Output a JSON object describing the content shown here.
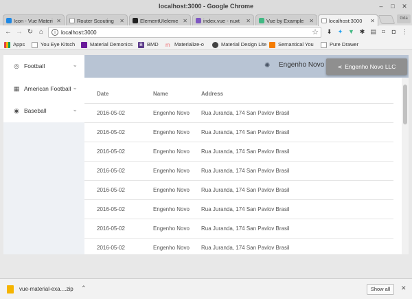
{
  "window": {
    "title": "localhost:3000 - Google Chrome"
  },
  "tabs": [
    {
      "label": "Icon - Vue Materi",
      "favicon_color": "#1e88e5",
      "active": false
    },
    {
      "label": "Router Scouting",
      "favicon_color": "#ffffff",
      "active": false
    },
    {
      "label": "ElementUIeleme",
      "favicon_color": "#222222",
      "active": false
    },
    {
      "label": "index.vue - nuxt",
      "favicon_color": "#7e57c2",
      "active": false
    },
    {
      "label": "Vue by Example",
      "favicon_color": "#41b883",
      "active": false
    },
    {
      "label": "localhost:3000",
      "favicon_color": "#ffffff",
      "active": true
    }
  ],
  "profile_label": "Gda",
  "toolbar": {
    "url": "localhost:3000"
  },
  "bookmarks": [
    {
      "label": "Apps",
      "icon_color": "#e04040"
    },
    {
      "label": "You Eye Kitsch",
      "icon_color": "#ffffff"
    },
    {
      "label": "Material Demonics",
      "icon_color": "#6a1b9a"
    },
    {
      "label": "BMD",
      "icon_color": "#5c3b8a"
    },
    {
      "label": "Materialize-o",
      "icon_color": "#ee6e73"
    },
    {
      "label": "Material Design Lite",
      "icon_color": "#424242"
    },
    {
      "label": "Semantical You",
      "icon_color": "#f57c00"
    },
    {
      "label": "Pure Drawer",
      "icon_color": "#ffffff"
    }
  ],
  "sidebar": {
    "items": [
      {
        "label": "Football",
        "icon": "football-icon"
      },
      {
        "label": "American Football",
        "icon": "grid-icon"
      },
      {
        "label": "Baseball",
        "icon": "baseball-icon"
      }
    ]
  },
  "appbar": {
    "title": "Engenho Novo",
    "button_label": "Engenho Novo LLC",
    "color": "#b8c4d4"
  },
  "table": {
    "columns": [
      "Date",
      "Name",
      "Address"
    ],
    "rows": [
      [
        "2016-05-02",
        "Engenho Novo",
        "Rua Juranda, 174 San Pavlov Brasil"
      ],
      [
        "2016-05-02",
        "Engenho Novo",
        "Rua Juranda, 174 San Pavlov Brasil"
      ],
      [
        "2016-05-02",
        "Engenho Novo",
        "Rua Juranda, 174 San Pavlov Brasil"
      ],
      [
        "2016-05-02",
        "Engenho Novo",
        "Rua Juranda, 174 San Pavlov Brasil"
      ],
      [
        "2016-05-02",
        "Engenho Novo",
        "Rua Juranda, 174 San Pavlov Brasil"
      ],
      [
        "2016-05-02",
        "Engenho Novo",
        "Rua Juranda, 174 San Pavlov Brasil"
      ],
      [
        "2016-05-02",
        "Engenho Novo",
        "Rua Juranda, 174 San Pavlov Brasil"
      ],
      [
        "2016-05-02",
        "Engenho Novo",
        "Rua Juranda, 174 San Pavlov Brasil"
      ]
    ]
  },
  "downloads": {
    "file_name": "vue-material-exa....zip",
    "show_all_label": "Show all"
  }
}
